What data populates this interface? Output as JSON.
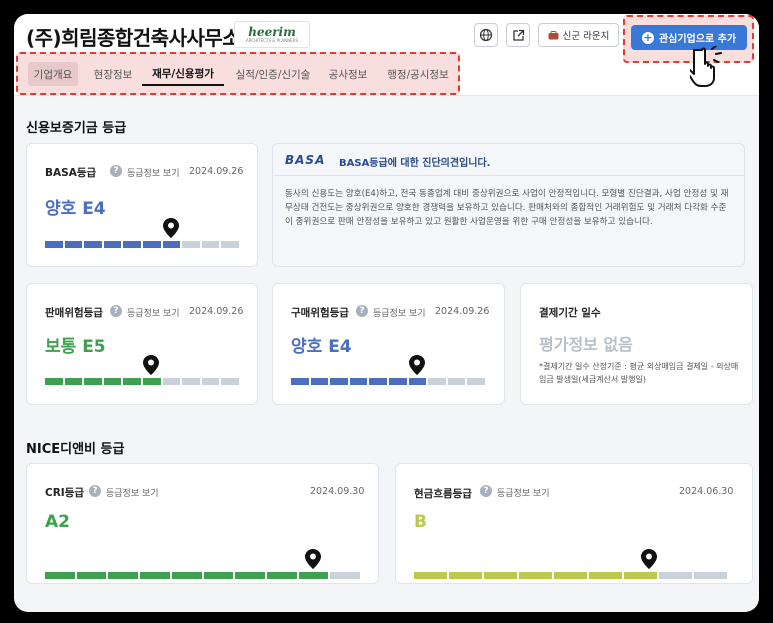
{
  "header": {
    "company_name": "(주)희림종합건축사사무소",
    "logo_text": "heerim",
    "logo_sub": "ARCHITECTS & PLANNERS",
    "lounge_label": "신군 라운지",
    "favorite_label": "관심기업으로 추가"
  },
  "tabs": [
    {
      "label": "기업개요"
    },
    {
      "label": "현장정보"
    },
    {
      "label": "재무/신용평가"
    },
    {
      "label": "실적/인증/신기술"
    },
    {
      "label": "공사정보"
    },
    {
      "label": "행정/공시정보"
    }
  ],
  "section_basa": "신용보증기금 등급",
  "section_nice": "NICE디앤비 등급",
  "grade_link_label": "등급정보 보기",
  "basa": {
    "title": "BASA등급",
    "date": "2024.09.26",
    "grade": "양호 E4",
    "level": 7,
    "segments": 10
  },
  "basa_opinion": {
    "logo": "BASA",
    "title": "BASA등급에 대한 진단의견입니다.",
    "body": "동사의 신용도는 양호(E4)하고, 전국 동종업계 대비 중상위권으로 사업이 안정적입니다. 모형별 진단결과, 사업 안정성 및 재무상태 건전도는 중상위권으로 양호한 경쟁력을 보유하고 있습니다. 판매처와의 종합적인 거래위험도 및 거래처 다각화 수준이 중위권으로 판매 안정성을 보유하고 있고 원활한 사업운영을 위한 구매 안정성을 보유하고 있습니다."
  },
  "sales_risk": {
    "title": "판매위험등급",
    "date": "2024.09.26",
    "grade": "보통 E5",
    "level": 6,
    "segments": 10
  },
  "purchase_risk": {
    "title": "구매위험등급",
    "date": "2024.09.26",
    "grade": "양호 E4",
    "level": 7,
    "segments": 10
  },
  "payment_period": {
    "title": "결제기간 일수",
    "no_eval": "평가정보 없음",
    "note": "*결제기간 일수 산정기준 : 평균 외상매입금 결제일 - 외상매입금 발생일(세금계산서 발행일)"
  },
  "cri": {
    "title": "CRI등급",
    "date": "2024.09.30",
    "grade": "A2",
    "level": 9,
    "segments": 10
  },
  "cash_flow": {
    "title": "현금흐름등급",
    "date": "2024.06.30",
    "grade": "B",
    "level": 7,
    "segments": 9
  },
  "colors": {
    "blue": "#4a6fc1",
    "green": "#3fa14f",
    "lime": "#bcc94b",
    "empty": "#c9d1da",
    "accent": "#3a78d8",
    "highlight": "#e53935"
  }
}
